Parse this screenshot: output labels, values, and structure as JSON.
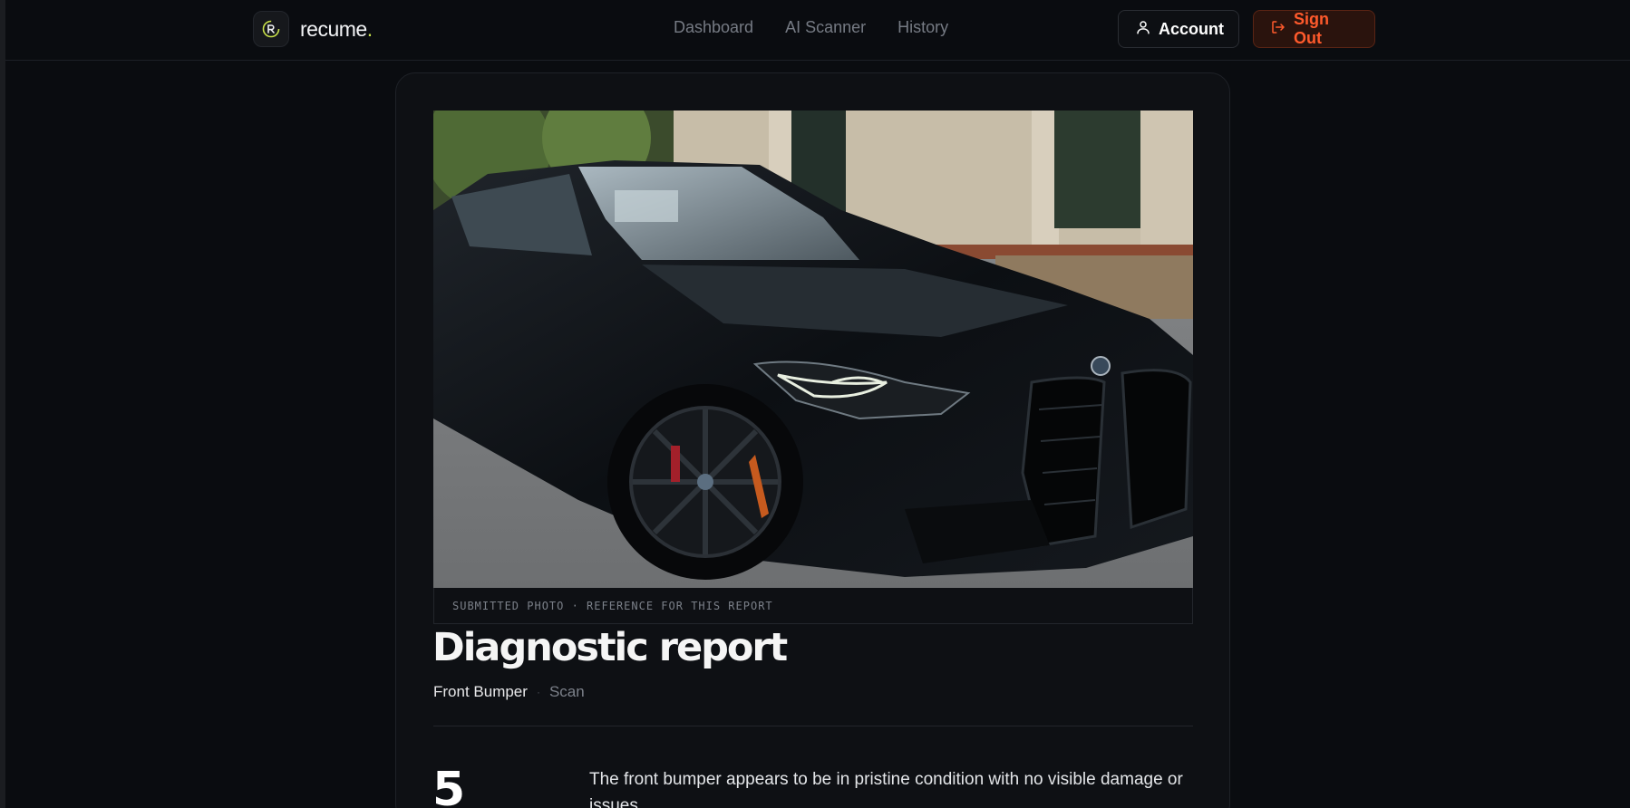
{
  "brand": {
    "name": "recume",
    "dot": "."
  },
  "nav": [
    {
      "label": "Dashboard"
    },
    {
      "label": "AI Scanner"
    },
    {
      "label": "History"
    }
  ],
  "actions": {
    "account_label": "Account",
    "signout_label": "Sign Out"
  },
  "report": {
    "photo_caption": "SUBMITTED PHOTO · REFERENCE FOR THIS REPORT",
    "title": "Diagnostic report",
    "part": "Front Bumper",
    "separator": "·",
    "type": "Scan",
    "score": "5",
    "summary": "The front bumper appears to be in pristine condition with no visible damage or issues."
  },
  "icons": {
    "logo": "recume-logo-icon",
    "account": "user-icon",
    "signout": "sign-out-icon"
  },
  "colors": {
    "accent": "#c8e04a",
    "danger": "#ff5a2c",
    "background": "#0a0c10"
  }
}
